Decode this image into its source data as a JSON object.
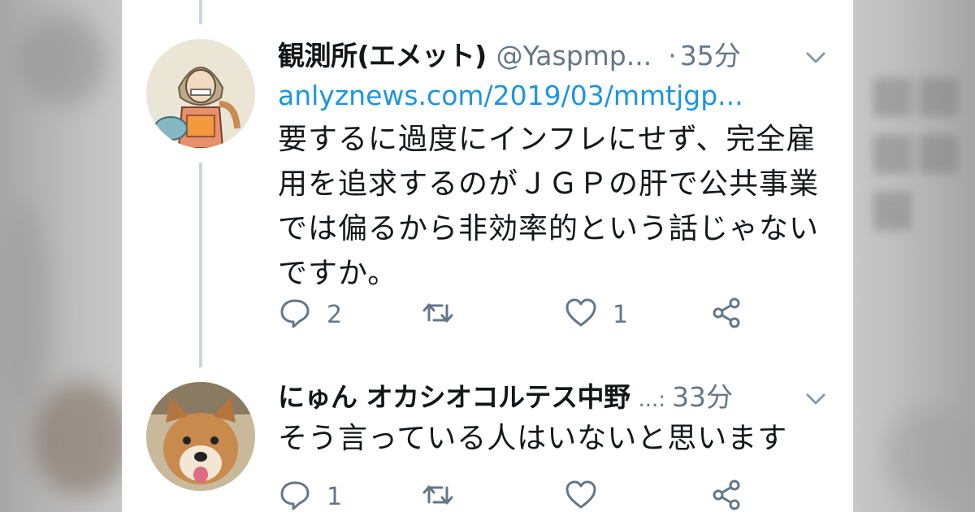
{
  "colors": {
    "name": "#14171a",
    "meta": "#657786",
    "link": "#1b95e0",
    "thread_line": "#cdd6dd"
  },
  "tweets": [
    {
      "name": "観測所(エメット)",
      "handle": "@Yaspmp...",
      "separator": "·",
      "time": "35分",
      "link": "anlyznews.com/2019/03/mmtjgp...",
      "lines": [
        "要するに過度にインフレにせず、完全雇",
        "用を追求するのがＪＧＰの肝で公共事業",
        "では偏るから非効率的という話じゃない",
        "ですか。"
      ],
      "reply_count": "2",
      "retweet_count": "",
      "like_count": "1",
      "icons": [
        "reply-icon",
        "retweet-icon",
        "like-icon",
        "share-icon",
        "chevron-down-icon"
      ]
    },
    {
      "name": "にゅん オカシオコルテス中野",
      "handle": "...:",
      "time": "33分",
      "lines": [
        "そう言っている人はいないと思います"
      ],
      "reply_count": "1",
      "retweet_count": "",
      "like_count": "",
      "icons": [
        "reply-icon",
        "retweet-icon",
        "like-icon",
        "share-icon",
        "chevron-down-icon"
      ]
    }
  ]
}
